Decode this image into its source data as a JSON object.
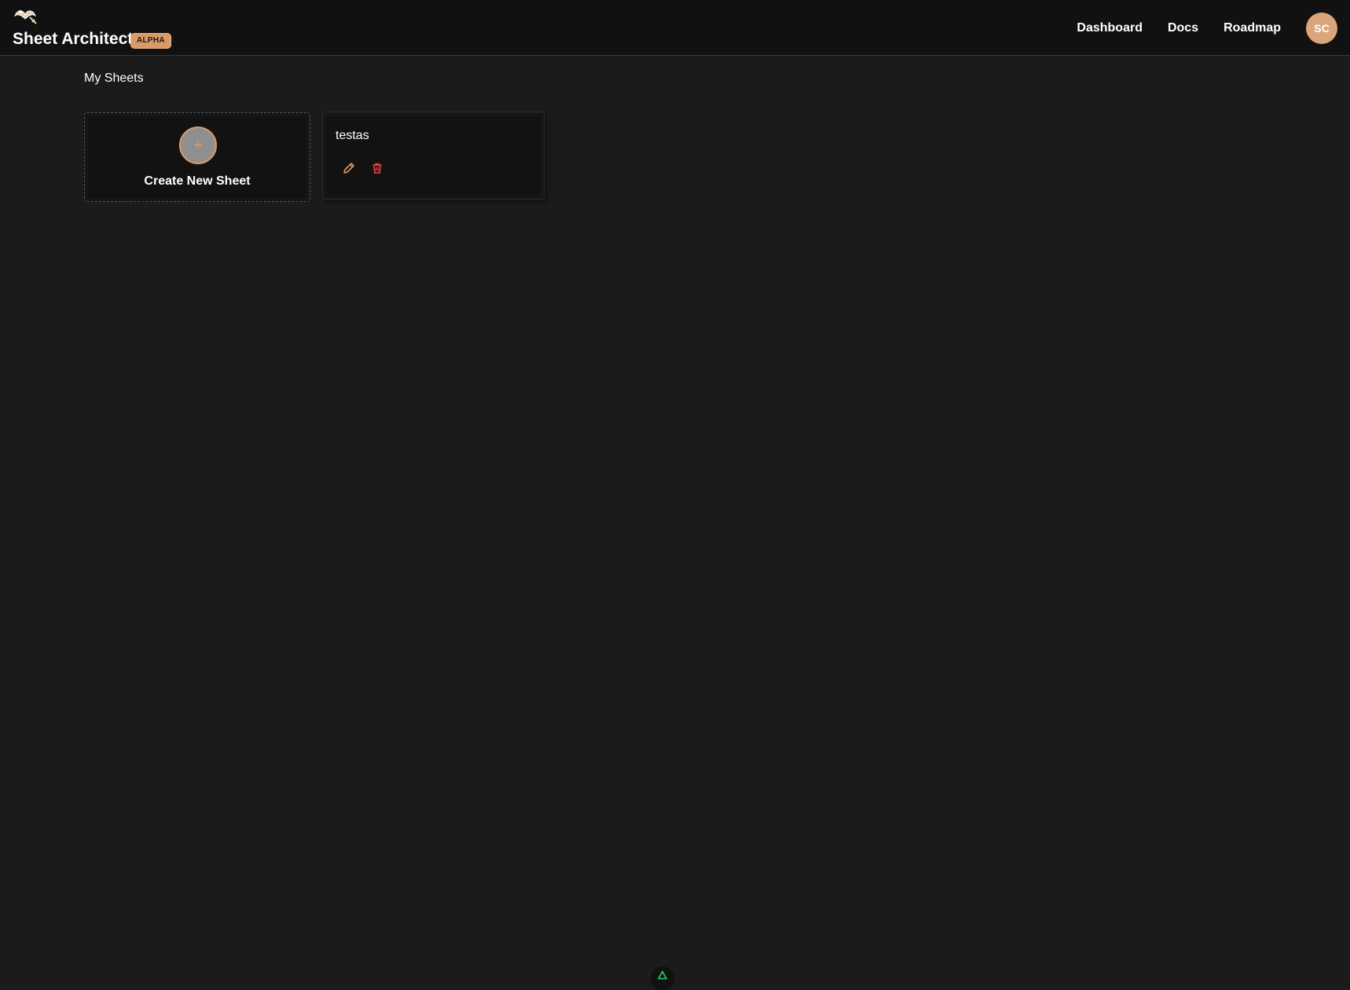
{
  "app": {
    "title": "Sheet Architect",
    "badge": "ALPHA"
  },
  "nav": {
    "items": [
      {
        "label": "Dashboard"
      },
      {
        "label": "Docs"
      },
      {
        "label": "Roadmap"
      }
    ],
    "avatar_initials": "SC"
  },
  "main": {
    "heading": "My Sheets",
    "create_card": {
      "plus": "+",
      "label": "Create New Sheet"
    },
    "sheets": [
      {
        "name": "testas"
      }
    ]
  },
  "colors": {
    "accent": "#d99a68",
    "danger": "#ef4444",
    "background": "#1b1b1b",
    "topbar": "#111111",
    "floating_icon": "#22c55e"
  },
  "icons": {
    "logo": "mustache-logo-icon",
    "edit": "pencil-icon",
    "delete": "trash-icon",
    "floating": "triangle-icon"
  }
}
